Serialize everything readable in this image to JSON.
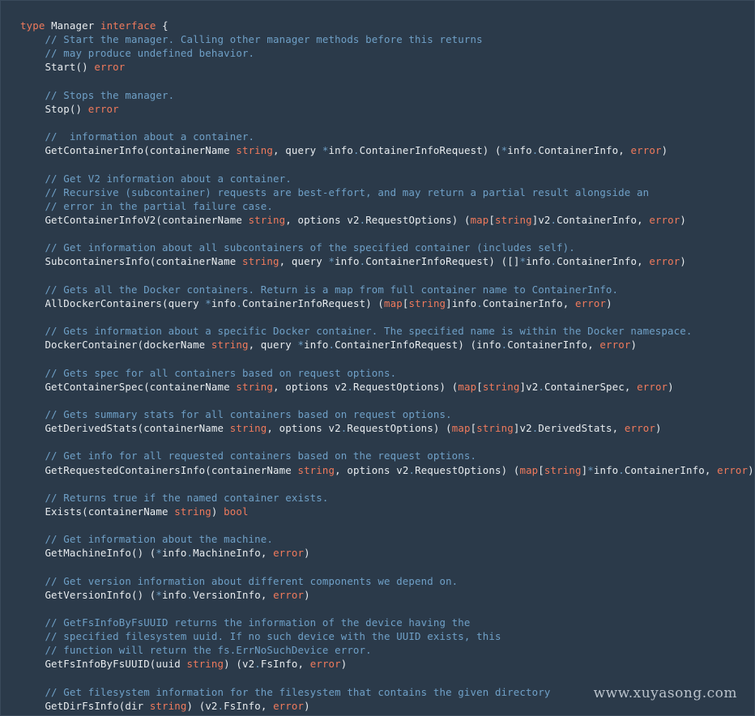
{
  "colors": {
    "background": "#2b3a4a",
    "plain": "#e8ecef",
    "keyword": "#f07a5c",
    "comment": "#6fa0c7"
  },
  "watermark": "www.xuyasong.com",
  "code_lines": [
    [
      [
        "keyword",
        "type"
      ],
      [
        "plain",
        " Manager "
      ],
      [
        "keyword",
        "interface"
      ],
      [
        "plain",
        " {"
      ]
    ],
    [
      [
        "comment",
        "    // Start the manager. Calling other manager methods before this returns"
      ]
    ],
    [
      [
        "comment",
        "    // may produce undefined behavior."
      ]
    ],
    [
      [
        "plain",
        "    Start() "
      ],
      [
        "type",
        "error"
      ]
    ],
    [],
    [
      [
        "comment",
        "    // Stops the manager."
      ]
    ],
    [
      [
        "plain",
        "    Stop() "
      ],
      [
        "type",
        "error"
      ]
    ],
    [],
    [
      [
        "comment",
        "    //  information about a container."
      ]
    ],
    [
      [
        "plain",
        "    GetContainerInfo(containerName "
      ],
      [
        "type",
        "string"
      ],
      [
        "plain",
        ", query "
      ],
      [
        "operator",
        "*"
      ],
      [
        "plain",
        "info"
      ],
      [
        "operator",
        "."
      ],
      [
        "plain",
        "ContainerInfoRequest) ("
      ],
      [
        "operator",
        "*"
      ],
      [
        "plain",
        "info"
      ],
      [
        "operator",
        "."
      ],
      [
        "plain",
        "ContainerInfo, "
      ],
      [
        "type",
        "error"
      ],
      [
        "plain",
        ")"
      ]
    ],
    [],
    [
      [
        "comment",
        "    // Get V2 information about a container."
      ]
    ],
    [
      [
        "comment",
        "    // Recursive (subcontainer) requests are best-effort, and may return a partial result alongside an"
      ]
    ],
    [
      [
        "comment",
        "    // error in the partial failure case."
      ]
    ],
    [
      [
        "plain",
        "    GetContainerInfoV2(containerName "
      ],
      [
        "type",
        "string"
      ],
      [
        "plain",
        ", options v2"
      ],
      [
        "operator",
        "."
      ],
      [
        "plain",
        "RequestOptions) ("
      ],
      [
        "type",
        "map"
      ],
      [
        "plain",
        "["
      ],
      [
        "type",
        "string"
      ],
      [
        "plain",
        "]v2"
      ],
      [
        "operator",
        "."
      ],
      [
        "plain",
        "ContainerInfo, "
      ],
      [
        "type",
        "error"
      ],
      [
        "plain",
        ")"
      ]
    ],
    [],
    [
      [
        "comment",
        "    // Get information about all subcontainers of the specified container (includes self)."
      ]
    ],
    [
      [
        "plain",
        "    SubcontainersInfo(containerName "
      ],
      [
        "type",
        "string"
      ],
      [
        "plain",
        ", query "
      ],
      [
        "operator",
        "*"
      ],
      [
        "plain",
        "info"
      ],
      [
        "operator",
        "."
      ],
      [
        "plain",
        "ContainerInfoRequest) ([]"
      ],
      [
        "operator",
        "*"
      ],
      [
        "plain",
        "info"
      ],
      [
        "operator",
        "."
      ],
      [
        "plain",
        "ContainerInfo, "
      ],
      [
        "type",
        "error"
      ],
      [
        "plain",
        ")"
      ]
    ],
    [],
    [
      [
        "comment",
        "    // Gets all the Docker containers. Return is a map from full container name to ContainerInfo."
      ]
    ],
    [
      [
        "plain",
        "    AllDockerContainers(query "
      ],
      [
        "operator",
        "*"
      ],
      [
        "plain",
        "info"
      ],
      [
        "operator",
        "."
      ],
      [
        "plain",
        "ContainerInfoRequest) ("
      ],
      [
        "type",
        "map"
      ],
      [
        "plain",
        "["
      ],
      [
        "type",
        "string"
      ],
      [
        "plain",
        "]info"
      ],
      [
        "operator",
        "."
      ],
      [
        "plain",
        "ContainerInfo, "
      ],
      [
        "type",
        "error"
      ],
      [
        "plain",
        ")"
      ]
    ],
    [],
    [
      [
        "comment",
        "    // Gets information about a specific Docker container. The specified name is within the Docker namespace."
      ]
    ],
    [
      [
        "plain",
        "    DockerContainer(dockerName "
      ],
      [
        "type",
        "string"
      ],
      [
        "plain",
        ", query "
      ],
      [
        "operator",
        "*"
      ],
      [
        "plain",
        "info"
      ],
      [
        "operator",
        "."
      ],
      [
        "plain",
        "ContainerInfoRequest) (info"
      ],
      [
        "operator",
        "."
      ],
      [
        "plain",
        "ContainerInfo, "
      ],
      [
        "type",
        "error"
      ],
      [
        "plain",
        ")"
      ]
    ],
    [],
    [
      [
        "comment",
        "    // Gets spec for all containers based on request options."
      ]
    ],
    [
      [
        "plain",
        "    GetContainerSpec(containerName "
      ],
      [
        "type",
        "string"
      ],
      [
        "plain",
        ", options v2"
      ],
      [
        "operator",
        "."
      ],
      [
        "plain",
        "RequestOptions) ("
      ],
      [
        "type",
        "map"
      ],
      [
        "plain",
        "["
      ],
      [
        "type",
        "string"
      ],
      [
        "plain",
        "]v2"
      ],
      [
        "operator",
        "."
      ],
      [
        "plain",
        "ContainerSpec, "
      ],
      [
        "type",
        "error"
      ],
      [
        "plain",
        ")"
      ]
    ],
    [],
    [
      [
        "comment",
        "    // Gets summary stats for all containers based on request options."
      ]
    ],
    [
      [
        "plain",
        "    GetDerivedStats(containerName "
      ],
      [
        "type",
        "string"
      ],
      [
        "plain",
        ", options v2"
      ],
      [
        "operator",
        "."
      ],
      [
        "plain",
        "RequestOptions) ("
      ],
      [
        "type",
        "map"
      ],
      [
        "plain",
        "["
      ],
      [
        "type",
        "string"
      ],
      [
        "plain",
        "]v2"
      ],
      [
        "operator",
        "."
      ],
      [
        "plain",
        "DerivedStats, "
      ],
      [
        "type",
        "error"
      ],
      [
        "plain",
        ")"
      ]
    ],
    [],
    [
      [
        "comment",
        "    // Get info for all requested containers based on the request options."
      ]
    ],
    [
      [
        "plain",
        "    GetRequestedContainersInfo(containerName "
      ],
      [
        "type",
        "string"
      ],
      [
        "plain",
        ", options v2"
      ],
      [
        "operator",
        "."
      ],
      [
        "plain",
        "RequestOptions) ("
      ],
      [
        "type",
        "map"
      ],
      [
        "plain",
        "["
      ],
      [
        "type",
        "string"
      ],
      [
        "plain",
        "]"
      ],
      [
        "operator",
        "*"
      ],
      [
        "plain",
        "info"
      ],
      [
        "operator",
        "."
      ],
      [
        "plain",
        "ContainerInfo, "
      ],
      [
        "type",
        "error"
      ],
      [
        "plain",
        ")"
      ]
    ],
    [],
    [
      [
        "comment",
        "    // Returns true if the named container exists."
      ]
    ],
    [
      [
        "plain",
        "    Exists(containerName "
      ],
      [
        "type",
        "string"
      ],
      [
        "plain",
        ") "
      ],
      [
        "type",
        "bool"
      ]
    ],
    [],
    [
      [
        "comment",
        "    // Get information about the machine."
      ]
    ],
    [
      [
        "plain",
        "    GetMachineInfo() ("
      ],
      [
        "operator",
        "*"
      ],
      [
        "plain",
        "info"
      ],
      [
        "operator",
        "."
      ],
      [
        "plain",
        "MachineInfo, "
      ],
      [
        "type",
        "error"
      ],
      [
        "plain",
        ")"
      ]
    ],
    [],
    [
      [
        "comment",
        "    // Get version information about different components we depend on."
      ]
    ],
    [
      [
        "plain",
        "    GetVersionInfo() ("
      ],
      [
        "operator",
        "*"
      ],
      [
        "plain",
        "info"
      ],
      [
        "operator",
        "."
      ],
      [
        "plain",
        "VersionInfo, "
      ],
      [
        "type",
        "error"
      ],
      [
        "plain",
        ")"
      ]
    ],
    [],
    [
      [
        "comment",
        "    // GetFsInfoByFsUUID returns the information of the device having the"
      ]
    ],
    [
      [
        "comment",
        "    // specified filesystem uuid. If no such device with the UUID exists, this"
      ]
    ],
    [
      [
        "comment",
        "    // function will return the fs.ErrNoSuchDevice error."
      ]
    ],
    [
      [
        "plain",
        "    GetFsInfoByFsUUID(uuid "
      ],
      [
        "type",
        "string"
      ],
      [
        "plain",
        ") (v2"
      ],
      [
        "operator",
        "."
      ],
      [
        "plain",
        "FsInfo, "
      ],
      [
        "type",
        "error"
      ],
      [
        "plain",
        ")"
      ]
    ],
    [],
    [
      [
        "comment",
        "    // Get filesystem information for the filesystem that contains the given directory"
      ]
    ],
    [
      [
        "plain",
        "    GetDirFsInfo(dir "
      ],
      [
        "type",
        "string"
      ],
      [
        "plain",
        ") (v2"
      ],
      [
        "operator",
        "."
      ],
      [
        "plain",
        "FsInfo, "
      ],
      [
        "type",
        "error"
      ],
      [
        "plain",
        ")"
      ]
    ]
  ]
}
